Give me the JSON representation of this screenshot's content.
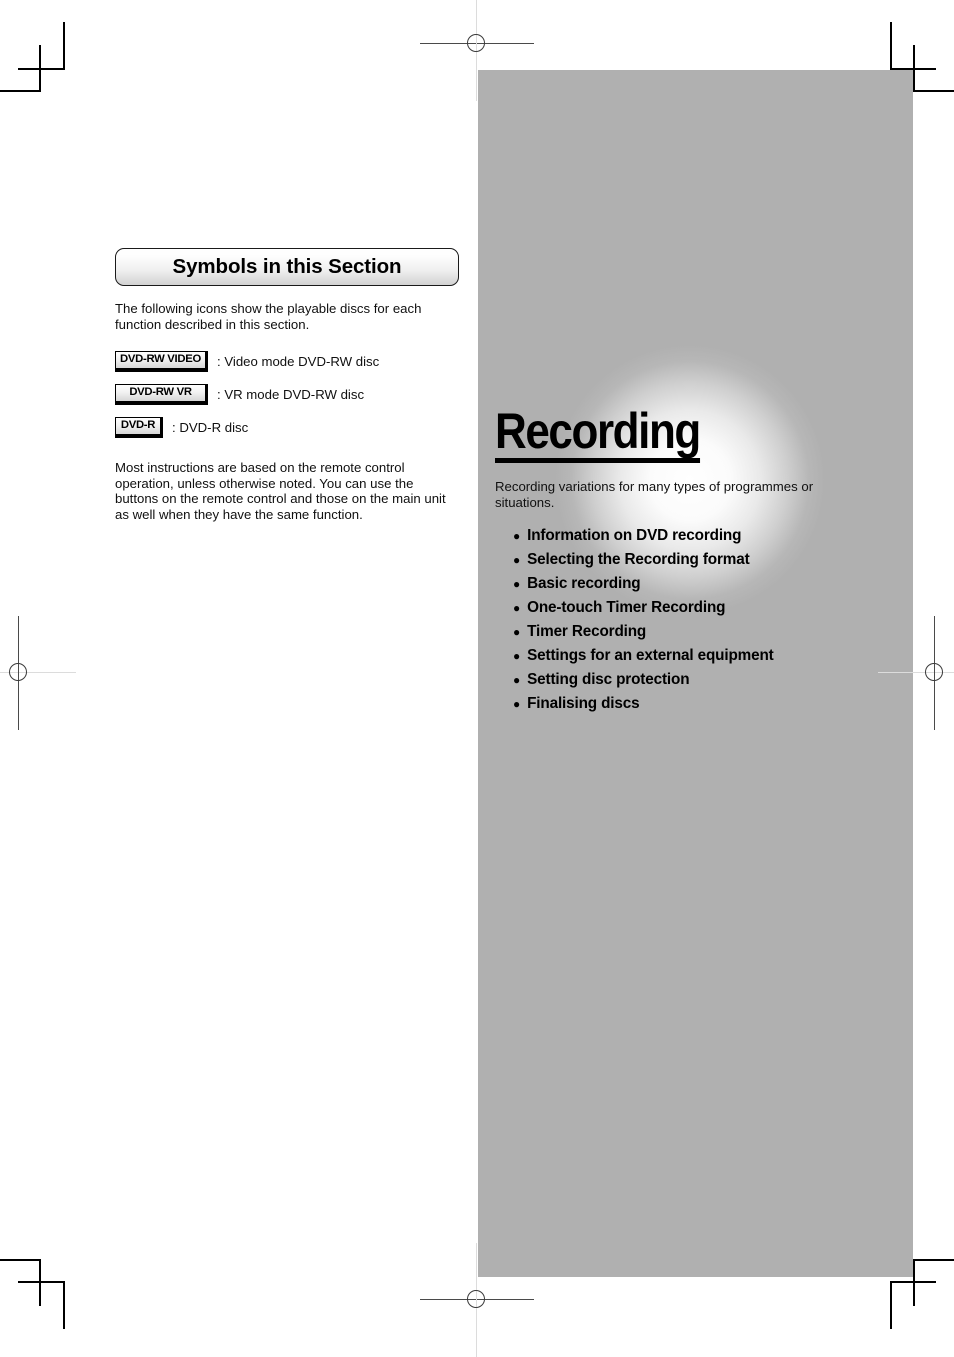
{
  "left_column": {
    "section_header": "Symbols in this Section",
    "intro_text": "The following icons show the playable discs for each function described in this section.",
    "badges": [
      {
        "label": "DVD-RW VIDEO",
        "caption": ": Video mode DVD-RW disc",
        "size": "wide"
      },
      {
        "label": "DVD-RW VR",
        "caption": ": VR mode DVD-RW disc",
        "size": "mid"
      },
      {
        "label": "DVD-R",
        "caption": ": DVD-R disc",
        "size": "small"
      }
    ],
    "note_text": "Most instructions are based on the remote control operation, unless otherwise noted.  You can use the buttons on the remote control and those on the main unit as well when they have the same function."
  },
  "right_panel": {
    "title": "Recording",
    "subtitle": "Recording variations for many types of programmes or situations.",
    "bullet_glyph": "●",
    "features": [
      "Information on DVD recording",
      "Selecting the Recording format",
      "Basic recording",
      "One-touch Timer Recording",
      "Timer Recording",
      "Settings for an external equipment",
      "Setting disc protection",
      "Finalising discs"
    ]
  },
  "colors": {
    "panel_gray": "#b0b0b0",
    "glow_white": "#ffffff",
    "text_black": "#000000",
    "crop_mark": "#000000"
  }
}
